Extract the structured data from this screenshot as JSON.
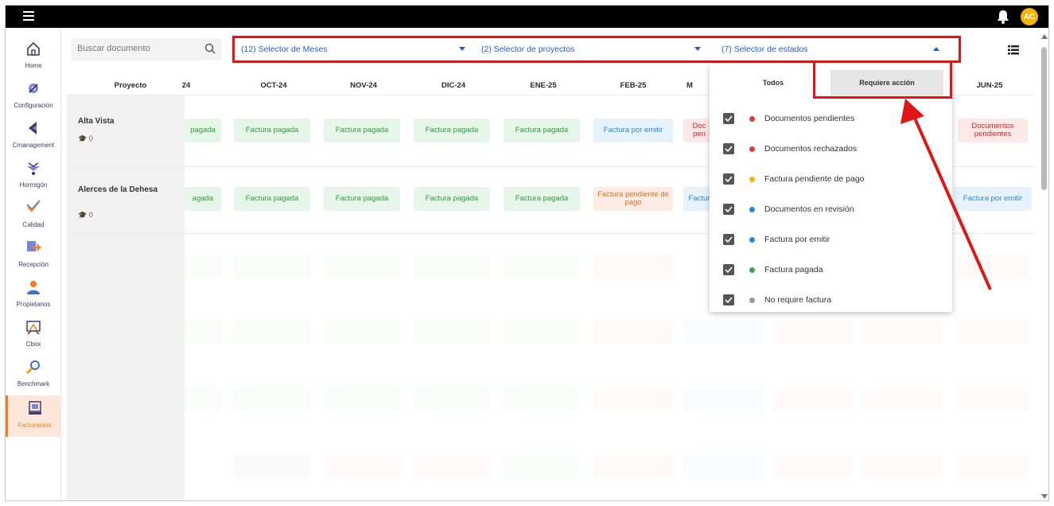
{
  "topbar": {
    "avatar_initials": "AC"
  },
  "sidebar": {
    "items": [
      {
        "label": "Home",
        "icon": "home-icon"
      },
      {
        "label": "Configuración",
        "icon": "gear-icon"
      },
      {
        "label": "Cmanagement",
        "icon": "cmanagement-icon"
      },
      {
        "label": "Hormigón",
        "icon": "concrete-mixer-icon"
      },
      {
        "label": "Calidad",
        "icon": "quality-check-icon"
      },
      {
        "label": "Recepción",
        "icon": "reception-icon"
      },
      {
        "label": "Propietarios",
        "icon": "owners-icon"
      },
      {
        "label": "Cbox",
        "icon": "cbox-icon"
      },
      {
        "label": "Benchmark",
        "icon": "benchmark-icon"
      },
      {
        "label": "Facturación",
        "icon": "billing-icon"
      }
    ],
    "active": "Facturación"
  },
  "search": {
    "placeholder": "Buscar documento"
  },
  "filters": {
    "months": "(12) Selector de Meses",
    "projects": "(2) Selector de proyectos",
    "states": "(7) Selector de estados"
  },
  "table": {
    "project_header": "Proyecto",
    "month_headers": [
      "24",
      "OCT-24",
      "NOV-24",
      "DIC-24",
      "ENE-25",
      "FEB-25",
      "M",
      "",
      "",
      "JUN-25"
    ],
    "projects": [
      {
        "name": "Alta Vista",
        "count": "0"
      },
      {
        "name": "Alerces de la Dehesa",
        "count": "0"
      }
    ],
    "row1": [
      "pagada",
      "Factura pagada",
      "Factura pagada",
      "Factura pagada",
      "Factura pagada",
      "Factura por emitir",
      "Doc pen",
      "Documentos pendientes"
    ],
    "row2": [
      "agada",
      "Factura pagada",
      "Factura pagada",
      "Factura pagada",
      "Factura pagada",
      "Factura pendiente de pago",
      "Factur",
      "Factura por emitir"
    ]
  },
  "state_dropdown": {
    "tabs": [
      "Todos",
      "Requiere acción"
    ],
    "selected_tab": "Requiere acción",
    "items": [
      {
        "label": "Documentos pendientes",
        "color": "#e53935",
        "checked": true
      },
      {
        "label": "Documentos rechazados",
        "color": "#e53935",
        "checked": true
      },
      {
        "label": "Factura pendiente de pago",
        "color": "#f5b400",
        "checked": true
      },
      {
        "label": "Documentos en revisión",
        "color": "#2c86d6",
        "checked": true
      },
      {
        "label": "Factura por emitir",
        "color": "#2c86d6",
        "checked": true
      },
      {
        "label": "Factura pagada",
        "color": "#3aa54a",
        "checked": true
      },
      {
        "label": "No require factura",
        "color": "#999999",
        "checked": true
      }
    ]
  },
  "colors": {
    "accent": "#f47b20",
    "highlight": "#e01515",
    "link": "#1f5fd3"
  }
}
